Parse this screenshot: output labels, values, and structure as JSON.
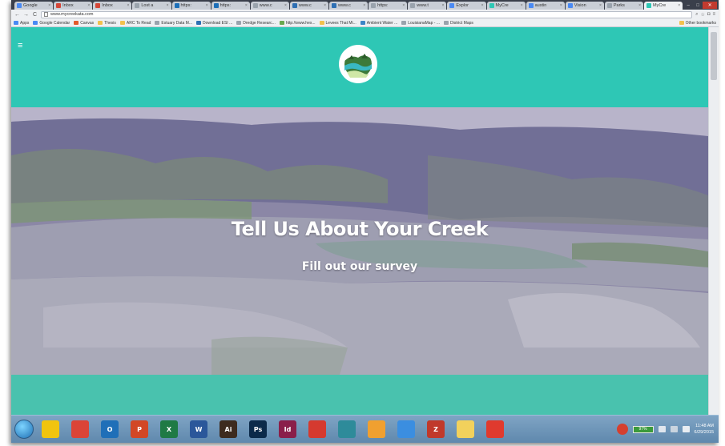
{
  "browser": {
    "tabs": [
      {
        "label": "Google",
        "color": "#4a8af4"
      },
      {
        "label": "Inbox",
        "color": "#d44638"
      },
      {
        "label": "Inbox",
        "color": "#d44638"
      },
      {
        "label": "Lost a",
        "color": "#9aa3ad"
      },
      {
        "label": "https:",
        "color": "#1d6fb8"
      },
      {
        "label": "https:",
        "color": "#1d6fb8"
      },
      {
        "label": "www.c",
        "color": "#9aa3ad"
      },
      {
        "label": "www.c",
        "color": "#2e6fb3"
      },
      {
        "label": "www.c",
        "color": "#2e6fb3"
      },
      {
        "label": "https:",
        "color": "#9aa3ad"
      },
      {
        "label": "www.t",
        "color": "#9aa3ad"
      },
      {
        "label": "Explor",
        "color": "#4a8af4"
      },
      {
        "label": "MyCre",
        "color": "#2ec7b5"
      },
      {
        "label": "austin",
        "color": "#4a8af4"
      },
      {
        "label": "Vision",
        "color": "#4a8af4"
      },
      {
        "label": "Parks",
        "color": "#9aa3ad"
      },
      {
        "label": "MyCre",
        "color": "#2ec7b5"
      }
    ],
    "active_tab_index": 16,
    "url": "www.mycreekata.com",
    "bookmarks": [
      {
        "label": "Apps",
        "color": "#4a8af4"
      },
      {
        "label": "Google Calendar",
        "color": "#4a8af4"
      },
      {
        "label": "Canvas",
        "color": "#e35a2b"
      },
      {
        "label": "Thesis",
        "color": "#f2c14e"
      },
      {
        "label": "ARC To Read",
        "color": "#f2c14e"
      },
      {
        "label": "Estuary Data M...",
        "color": "#9aa3ad"
      },
      {
        "label": "Download ESI ...",
        "color": "#2e6fb3"
      },
      {
        "label": "Dredge Researc...",
        "color": "#9aa3ad"
      },
      {
        "label": "http://www.hex...",
        "color": "#6aa84f"
      },
      {
        "label": "Levees That Mi...",
        "color": "#f2c14e"
      },
      {
        "label": "Ambient Water ...",
        "color": "#3d85c6"
      },
      {
        "label": "LouisianaMap - ...",
        "color": "#9aa3ad"
      },
      {
        "label": "District Maps",
        "color": "#9aa3ad"
      }
    ],
    "other_bookmarks": "Other bookmarks"
  },
  "site": {
    "menu_icon": "hamburger-menu-icon",
    "logo_icon": "creek-logo-icon",
    "colors": {
      "header": "#2ec7b5",
      "band": "#49c2ae",
      "hero_tint": "#8e8aa6"
    },
    "hero": {
      "title": "Tell Us About Your Creek",
      "subtitle": "Fill out our survey"
    }
  },
  "taskbar": {
    "apps": [
      {
        "name": "explorer-folder",
        "label": "",
        "color": "#f1c40f"
      },
      {
        "name": "chrome",
        "label": "",
        "color": "#db4437"
      },
      {
        "name": "outlook",
        "label": "O",
        "color": "#1f6fb8"
      },
      {
        "name": "powerpoint",
        "label": "P",
        "color": "#d24726"
      },
      {
        "name": "excel",
        "label": "X",
        "color": "#1f7a45"
      },
      {
        "name": "word",
        "label": "W",
        "color": "#2b579a"
      },
      {
        "name": "illustrator",
        "label": "Ai",
        "color": "#3d2b1f"
      },
      {
        "name": "photoshop",
        "label": "Ps",
        "color": "#0b2a4a"
      },
      {
        "name": "indesign",
        "label": "Id",
        "color": "#8a1f4a"
      },
      {
        "name": "app-red",
        "label": "",
        "color": "#d53a2f"
      },
      {
        "name": "app-search",
        "label": "",
        "color": "#2e8b9a"
      },
      {
        "name": "app-arcgis",
        "label": "",
        "color": "#f0a030"
      },
      {
        "name": "google-drive",
        "label": "",
        "color": "#3b8ee0"
      },
      {
        "name": "app-zotero",
        "label": "Z",
        "color": "#c0392b"
      },
      {
        "name": "app-folder2",
        "label": "",
        "color": "#f2d15c"
      },
      {
        "name": "acrobat",
        "label": "",
        "color": "#e03a2e"
      }
    ],
    "battery": "97%",
    "clock_time": "11:48 AM",
    "clock_date": "6/29/2015"
  }
}
